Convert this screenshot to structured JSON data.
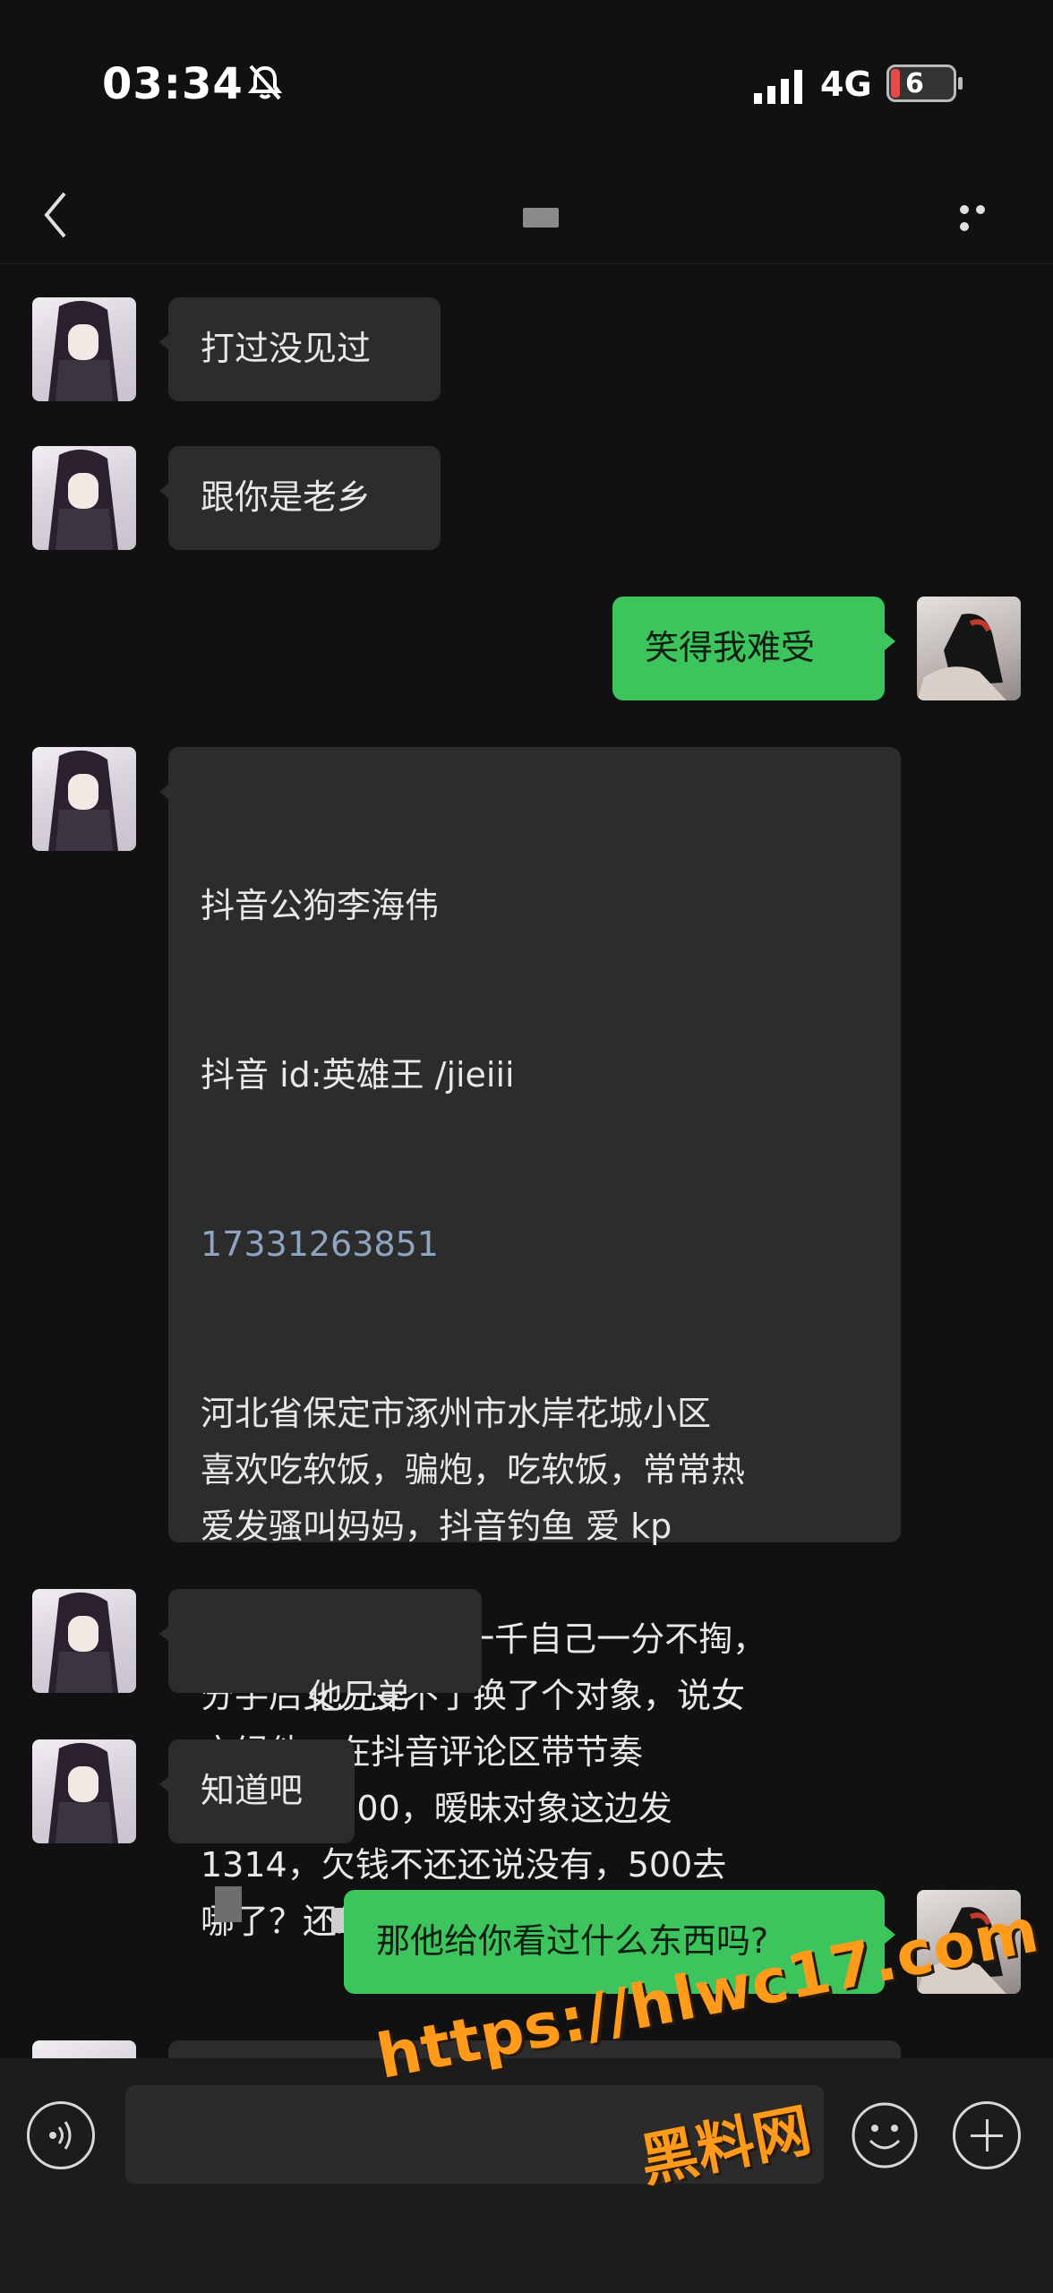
{
  "status": {
    "time": "03:34",
    "network": "4G",
    "battery": "6"
  },
  "nav": {
    "back_icon": "chevron-left-icon",
    "more_icon": "more-dots-icon"
  },
  "messages": [
    {
      "side": "left",
      "text": "打过没见过"
    },
    {
      "side": "left",
      "text": "跟你是老乡"
    },
    {
      "side": "right",
      "text": "笑得我难受"
    },
    {
      "side": "left",
      "line1": "抖音公狗李海伟",
      "line2": "抖音 id:英雄王 /jieiii",
      "phone": "17331263851",
      "body": "河北省保定市涿州市水岸花城小区\n喜欢吃软饭，骗炮，吃软饭，常常热\n爱发骚叫妈妈，抖音钓鱼 爱 kp\n\n1网恋奔现花女友一千自己一分不掏，\n分手后女方受不了换了个对象，说女\n方绿他，在抖音评论区带节奏\n2问我借 500，暧昧对象这边发\n1314，欠钱不还还说没有，500去\n哪了？还给我绿了"
    },
    {
      "side": "left",
      "text": "他兄弟"
    },
    {
      "side": "left",
      "text": "知道吧"
    },
    {
      "side": "right",
      "text": "那他给你看过什么东西吗?"
    }
  ],
  "watermark": {
    "url": "https://hlwc17.com",
    "name": "黑料网"
  },
  "icons": {
    "voice": "voice-icon",
    "emoji": "emoji-icon",
    "plus": "plus-icon"
  },
  "colors": {
    "background": "#111111",
    "bubble_left": "#2c2c2c",
    "bubble_right": "#3ec45c",
    "watermark": "#ff9a1a"
  }
}
